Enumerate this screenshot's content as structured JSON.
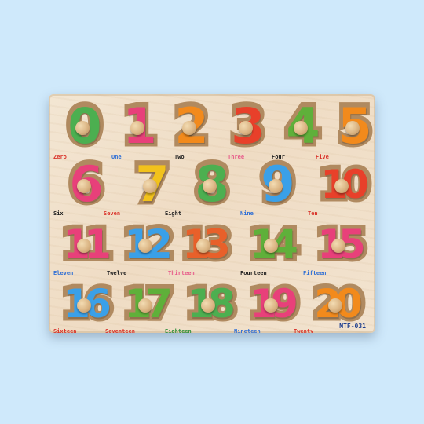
{
  "puzzle": {
    "code": "MTF-031",
    "pieces": [
      {
        "numeral": "0",
        "word": "Zero",
        "color": "#4caf50",
        "word_color": "#d9342b"
      },
      {
        "numeral": "1",
        "word": "One",
        "color": "#e8407a",
        "word_color": "#2f6fd6"
      },
      {
        "numeral": "2",
        "word": "Two",
        "color": "#f28a1c",
        "word_color": "#222222"
      },
      {
        "numeral": "3",
        "word": "Three",
        "color": "#e8402a",
        "word_color": "#e85a8a"
      },
      {
        "numeral": "4",
        "word": "Four",
        "color": "#5fb03a",
        "word_color": "#222222"
      },
      {
        "numeral": "5",
        "word": "Five",
        "color": "#f28a1c",
        "word_color": "#d9342b"
      },
      {
        "numeral": "6",
        "word": "Six",
        "color": "#e8407a",
        "word_color": "#222222"
      },
      {
        "numeral": "7",
        "word": "Seven",
        "color": "#f2c21c",
        "word_color": "#d9342b"
      },
      {
        "numeral": "8",
        "word": "Eight",
        "color": "#4caf50",
        "word_color": "#222222"
      },
      {
        "numeral": "9",
        "word": "Nine",
        "color": "#3aa0e8",
        "word_color": "#2f6fd6"
      },
      {
        "numeral": "10",
        "word": "Ten",
        "color": "#e8402a",
        "word_color": "#d9342b"
      },
      {
        "numeral": "11",
        "word": "Eleven",
        "color": "#e8407a",
        "word_color": "#2f6fd6"
      },
      {
        "numeral": "12",
        "word": "Twelve",
        "color": "#3aa0e8",
        "word_color": "#222222"
      },
      {
        "numeral": "13",
        "word": "Thirteen",
        "color": "#e8602a",
        "word_color": "#e85a8a"
      },
      {
        "numeral": "14",
        "word": "Fourteen",
        "color": "#5fb03a",
        "word_color": "#222222"
      },
      {
        "numeral": "15",
        "word": "Fifteen",
        "color": "#e8407a",
        "word_color": "#2f6fd6"
      },
      {
        "numeral": "16",
        "word": "Sixteen",
        "color": "#3aa0e8",
        "word_color": "#d9342b"
      },
      {
        "numeral": "17",
        "word": "Seventeen",
        "color": "#5fb03a",
        "word_color": "#d9342b"
      },
      {
        "numeral": "18",
        "word": "Eighteen",
        "color": "#4caf50",
        "word_color": "#2f8f3a"
      },
      {
        "numeral": "19",
        "word": "Nineteen",
        "color": "#e8407a",
        "word_color": "#2f6fd6"
      },
      {
        "numeral": "20",
        "word": "Twenty",
        "color": "#f28a1c",
        "word_color": "#d9342b"
      }
    ]
  }
}
